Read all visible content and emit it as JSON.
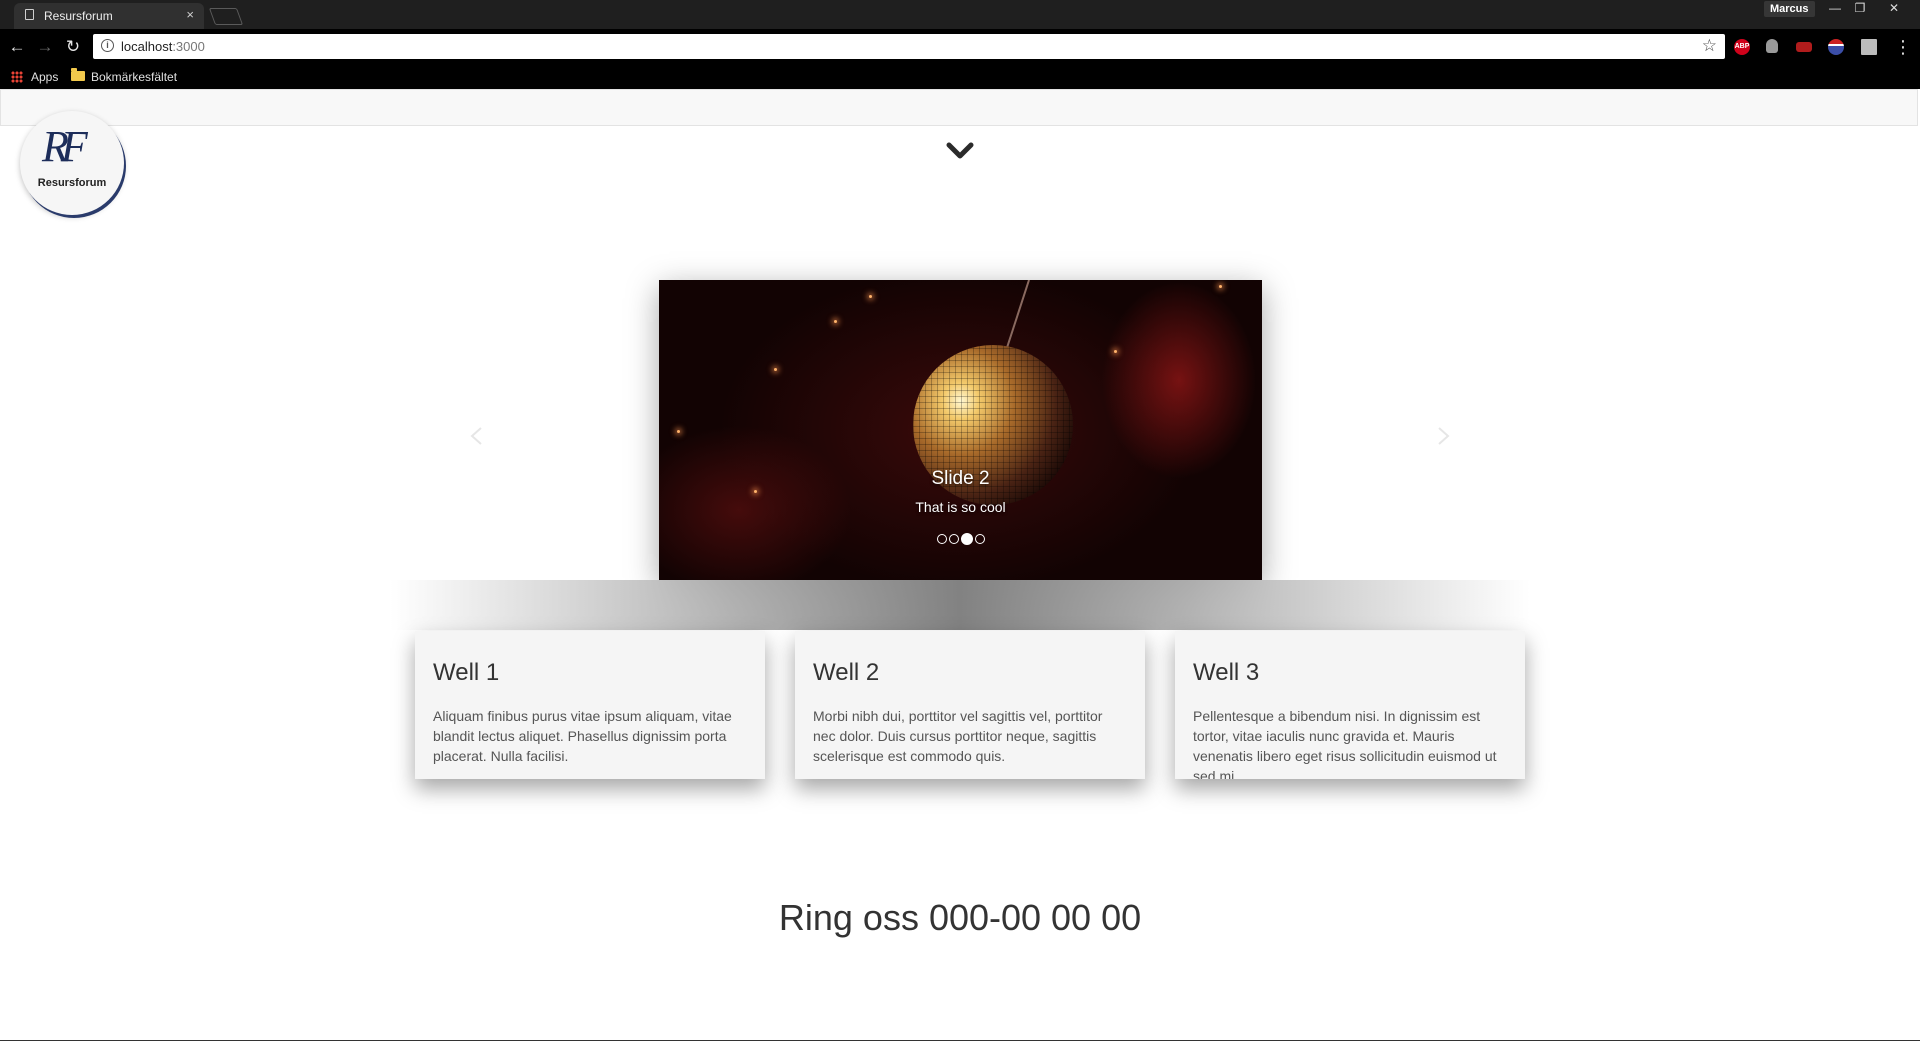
{
  "browser": {
    "tab_title": "Resursforum",
    "tab_close": "×",
    "profile_name": "Marcus",
    "window_controls": {
      "minimize": "—",
      "restore": "❐",
      "close": "✕"
    },
    "nav": {
      "back": "←",
      "forward": "→",
      "reload": "↻"
    },
    "url_host": "localhost",
    "url_port": ":3000",
    "star": "☆",
    "menu": "⋮",
    "extensions": [
      {
        "name": "adblock-icon",
        "label": "ABP",
        "color": "#d0021b"
      },
      {
        "name": "lightbulb-icon",
        "label": "",
        "color": "#9a9a9a"
      },
      {
        "name": "extension-red-icon",
        "label": "",
        "color": "#b01c1c"
      },
      {
        "name": "extension-flag-icon",
        "label": "",
        "color": "#3b4ea8"
      },
      {
        "name": "extension-square-icon",
        "label": "",
        "color": "#bcbcbc"
      }
    ],
    "bookmarks": {
      "apps": "Apps",
      "folder": "Bokmärkesfältet"
    }
  },
  "site": {
    "logo": {
      "mark": "RF",
      "name": "Resursforum"
    },
    "carousel": {
      "slide_title": "Slide 2",
      "slide_text": "That is so cool",
      "slide_count": 4,
      "active_index": 2,
      "prev": "‹",
      "next": "›"
    },
    "wells": [
      {
        "title": "Well 1",
        "text": "Aliquam finibus purus vitae ipsum aliquam, vitae blandit lectus aliquet. Phasellus dignissim porta placerat. Nulla facilisi."
      },
      {
        "title": "Well 2",
        "text": "Morbi nibh dui, porttitor vel sagittis vel, porttitor nec dolor. Duis cursus porttitor neque, sagittis scelerisque est commodo quis."
      },
      {
        "title": "Well 3",
        "text": "Pellentesque a bibendum nisi. In dignissim est tortor, vitae iaculis nunc gravida et. Mauris venenatis libero eget risus sollicitudin euismod ut sed mi."
      }
    ],
    "call_to_action": "Ring oss 000-00 00 00"
  }
}
